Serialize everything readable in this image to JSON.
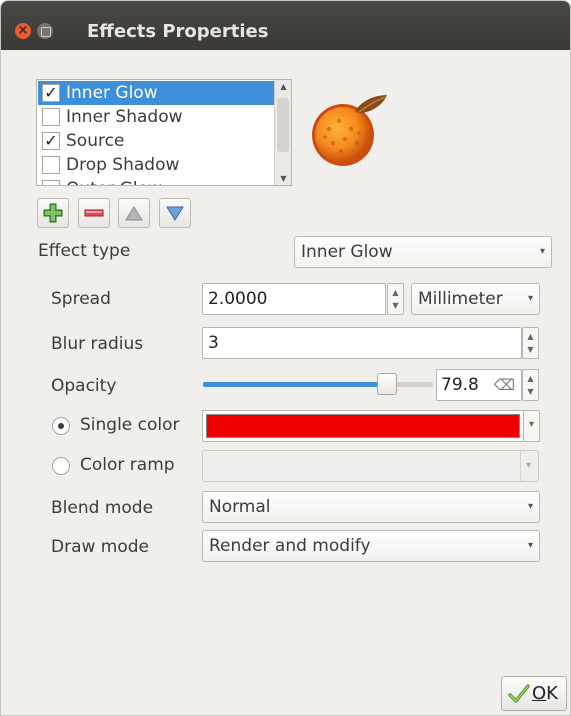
{
  "window": {
    "title": "Effects Properties",
    "close_glyph": "×"
  },
  "effects_list": {
    "items": [
      {
        "label": "Inner Glow",
        "checked": true,
        "selected": true
      },
      {
        "label": "Inner Shadow",
        "checked": false,
        "selected": false
      },
      {
        "label": "Source",
        "checked": true,
        "selected": false
      },
      {
        "label": "Drop Shadow",
        "checked": false,
        "selected": false
      },
      {
        "label": "Outer Glow",
        "checked": false,
        "selected": false
      }
    ],
    "check_glyph": "✓"
  },
  "toolbar": {
    "add_icon": "plus-icon",
    "remove_icon": "minus-icon",
    "up_icon": "arrow-up-icon",
    "down_icon": "arrow-down-icon"
  },
  "effect_type": {
    "label": "Effect type",
    "value": "Inner Glow"
  },
  "spread": {
    "label": "Spread",
    "value": "2.0000",
    "unit": "Millimeter"
  },
  "blur_radius": {
    "label": "Blur radius",
    "value": "3"
  },
  "opacity": {
    "label": "Opacity",
    "value": "79.8",
    "fraction": 0.798,
    "clear_glyph": "⌫"
  },
  "single_color": {
    "label": "Single color",
    "selected": true,
    "color": "#ee0000"
  },
  "color_ramp": {
    "label": "Color ramp",
    "selected": false
  },
  "blend_mode": {
    "label": "Blend mode",
    "value": "Normal"
  },
  "draw_mode": {
    "label": "Draw mode",
    "value": "Render and modify"
  },
  "footer": {
    "ok_prefix": "",
    "ok_underlined": "O",
    "ok_rest": "K"
  },
  "colors": {
    "accent": "#3c8fd8",
    "titlebar": "#3b3935",
    "window_bg": "#f1efec"
  }
}
